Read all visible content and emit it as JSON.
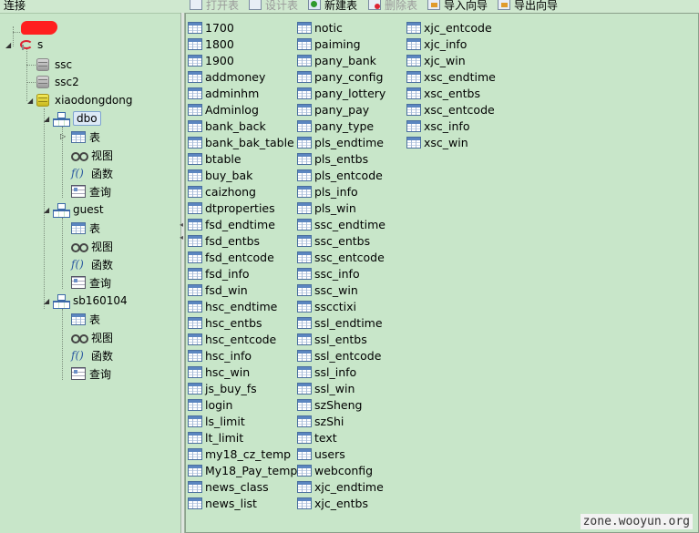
{
  "toolbar": {
    "connection_label": "连接",
    "open_table": "打开表",
    "design_table": "设计表",
    "new_table": "新建表",
    "delete_table": "删除表",
    "import_wizard": "导入向导",
    "export_wizard": "导出向导"
  },
  "tree": {
    "connection_name": "s",
    "databases": [
      "ssc",
      "ssc2",
      "xiaodongdong"
    ],
    "schemas": [
      {
        "name": "dbo",
        "children": [
          "表",
          "视图",
          "函数",
          "查询"
        ]
      },
      {
        "name": "guest",
        "children": [
          "表",
          "视图",
          "函数",
          "查询"
        ]
      },
      {
        "name": "sb160104",
        "children": [
          "表",
          "视图",
          "函数",
          "查询"
        ]
      }
    ]
  },
  "tables": {
    "col1": [
      "1700",
      "1800",
      "1900",
      "addmoney",
      "adminhm",
      "Adminlog",
      "bank_back",
      "bank_bak_table",
      "btable",
      "buy_bak",
      "caizhong",
      "dtproperties",
      "fsd_endtime",
      "fsd_entbs",
      "fsd_entcode",
      "fsd_info",
      "fsd_win",
      "hsc_endtime",
      "hsc_entbs",
      "hsc_entcode",
      "hsc_info",
      "hsc_win",
      "js_buy_fs",
      "login",
      "ls_limit",
      "lt_limit",
      "my18_cz_temp",
      "My18_Pay_temp",
      "news_class",
      "news_list"
    ],
    "col2": [
      "notic",
      "paiming",
      "pany_bank",
      "pany_config",
      "pany_lottery",
      "pany_pay",
      "pany_type",
      "pls_endtime",
      "pls_entbs",
      "pls_entcode",
      "pls_info",
      "pls_win",
      "ssc_endtime",
      "ssc_entbs",
      "ssc_entcode",
      "ssc_info",
      "ssc_win",
      "sscctixi",
      "ssl_endtime",
      "ssl_entbs",
      "ssl_entcode",
      "ssl_info",
      "ssl_win",
      "szSheng",
      "szShi",
      "text",
      "users",
      "webconfig",
      "xjc_endtime",
      "xjc_entbs"
    ],
    "col3": [
      "xjc_entcode",
      "xjc_info",
      "xjc_win",
      "xsc_endtime",
      "xsc_entbs",
      "xsc_entcode",
      "xsc_info",
      "xsc_win"
    ]
  },
  "watermark": "zone.wooyun.org"
}
